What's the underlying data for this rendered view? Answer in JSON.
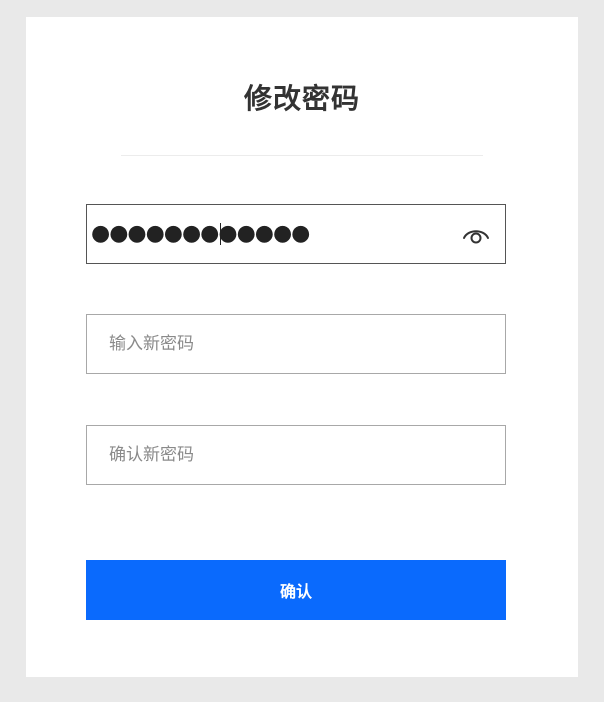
{
  "page": {
    "title": "修改密码"
  },
  "form": {
    "current_password": {
      "value_masked": "●●●●●●●●●●●●",
      "visibility_icon": "eye-icon"
    },
    "new_password": {
      "placeholder": "输入新密码",
      "value": ""
    },
    "confirm_password": {
      "placeholder": "确认新密码",
      "value": ""
    },
    "submit_label": "确认"
  },
  "colors": {
    "primary": "#0a6afd",
    "background": "#e9e9e9",
    "card": "#ffffff"
  }
}
